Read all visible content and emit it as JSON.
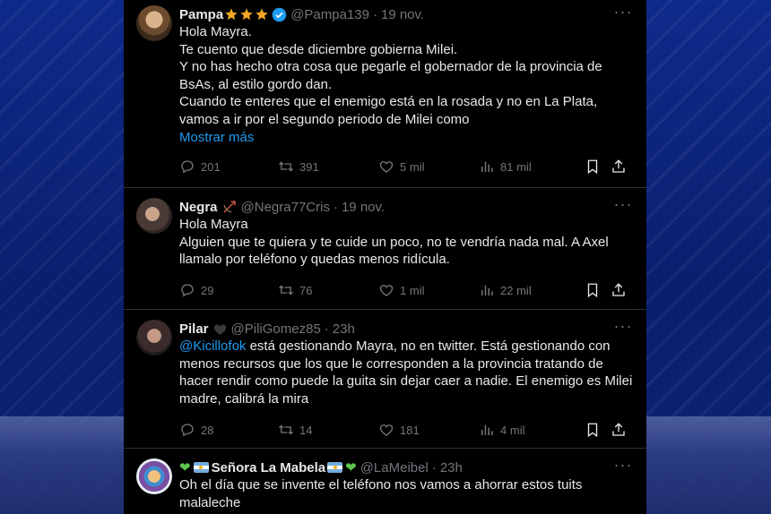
{
  "tweets": [
    {
      "name": "Pampa",
      "handle": "@Pampa139",
      "time": "19 nov.",
      "lines": [
        "Hola Mayra.",
        "Te cuento que desde diciembre gobierna Milei.",
        "Y no has hecho otra cosa que pegarle el gobernador de la provincia de BsAs, al estilo gordo dan.",
        "Cuando te enteres que el enemigo está en la rosada y no en La Plata, vamos a ir por el segundo periodo de Milei como"
      ],
      "show_more": "Mostrar más",
      "replies": "201",
      "reposts": "391",
      "likes": "5 mil",
      "views": "81 mil"
    },
    {
      "name": "Negra",
      "handle": "@Negra77Cris",
      "time": "19 nov.",
      "lines": [
        "Hola Mayra",
        "Alguien que te quiera y te cuide un poco, no te vendría nada mal. A Axel llamalo por teléfono y quedas menos ridícula."
      ],
      "replies": "29",
      "reposts": "76",
      "likes": "1 mil",
      "views": "22 mil"
    },
    {
      "name": "Pilar",
      "handle": "@PiliGomez85",
      "time": "23h",
      "mention": "@Kicillofok",
      "text_after_mention": " está gestionando Mayra, no en twitter. Está gestionando con menos recursos que los que le corresponden a la provincia tratando de hacer rendir como puede la guita sin dejar caer a nadie. El enemigo es Milei madre, calibrá la mira",
      "replies": "28",
      "reposts": "14",
      "likes": "181",
      "views": "4 mil"
    },
    {
      "name": "Señora La Mabela",
      "handle": "@LaMeibel",
      "time": "23h",
      "lines": [
        "Oh el día que se invente el teléfono nos vamos a ahorrar estos tuits malaleche"
      ]
    }
  ],
  "icons": {
    "reply": "reply-icon",
    "repost": "repost-icon",
    "like": "heart-icon",
    "views": "views-icon",
    "bookmark": "bookmark-icon",
    "share": "share-icon",
    "more": "more-icon"
  },
  "colors": {
    "link": "#1d9bf0",
    "muted": "#71767b",
    "verified": "#1d9bf0",
    "star": "#f5a623"
  }
}
